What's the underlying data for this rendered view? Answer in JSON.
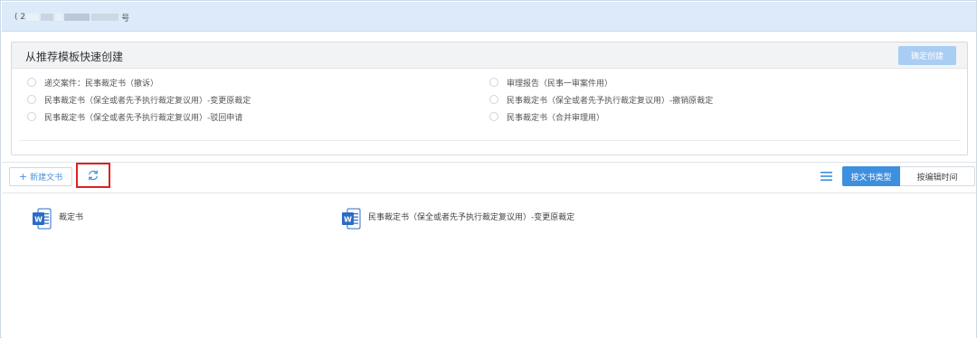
{
  "case_bar": {
    "prefix": "( 2",
    "suffix": "号"
  },
  "template_panel": {
    "title": "从推荐模板快速创建",
    "confirm_label": "确定创建",
    "templates": [
      {
        "label": "递交案件：民事裁定书（撤诉）"
      },
      {
        "label": "审理报告（民事一审案件用）"
      },
      {
        "label": "民事裁定书（保全或者先予执行裁定复议用）-变更原裁定"
      },
      {
        "label": "民事裁定书（保全或者先予执行裁定复议用）-撤销原裁定"
      },
      {
        "label": "民事裁定书（保全或者先予执行裁定复议用）-驳回申请"
      },
      {
        "label": "民事裁定书（合并审理用）"
      }
    ]
  },
  "toolbar": {
    "new_doc_label": "新建文书",
    "new_doc_icon": "plus-icon",
    "refresh_icon": "refresh-icon",
    "list_icon": "list-icon",
    "view_by_type": "按文书类型",
    "view_by_time": "按编辑时间"
  },
  "documents": [
    {
      "name": "裁定书",
      "icon": "word-doc-icon"
    },
    {
      "name": "民事裁定书（保全或者先予执行裁定复议用）-变更原裁定",
      "icon": "word-doc-icon"
    }
  ],
  "colors": {
    "accent": "#3d8fe0",
    "titlebar_bg": "#dceafa",
    "highlight_border": "#e02020",
    "confirm_disabled": "#a9cdf3"
  }
}
